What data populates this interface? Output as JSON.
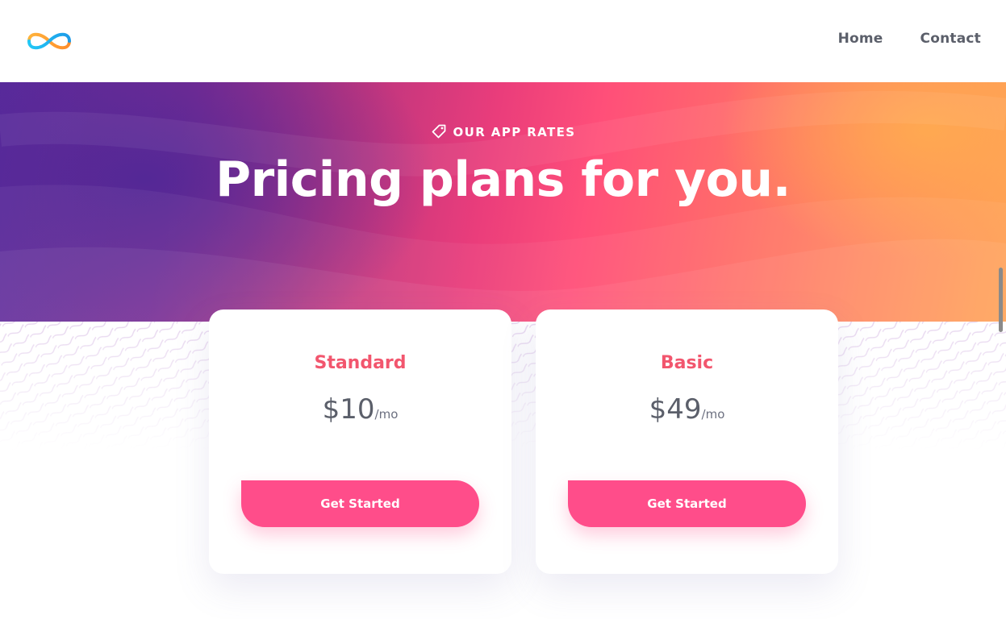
{
  "nav": {
    "logo_icon": "infinity-logo-icon",
    "items": [
      {
        "label": "Home"
      },
      {
        "label": "Contact"
      }
    ]
  },
  "hero": {
    "eyebrow_icon": "price-tag-icon",
    "eyebrow": "OUR APP RATES",
    "title": "Pricing plans for you."
  },
  "plans": [
    {
      "name": "Standard",
      "price": "$10",
      "period": "/mo",
      "cta": "Get Started"
    },
    {
      "name": "Basic",
      "price": "$49",
      "period": "/mo",
      "cta": "Get Started"
    }
  ],
  "colors": {
    "accent": "#ff4d8a",
    "plan_name": "#f2566e",
    "text": "#5b5f6a",
    "hero_start": "#5a2a9c",
    "hero_mid": "#ff4f79",
    "hero_end": "#ffa255"
  }
}
